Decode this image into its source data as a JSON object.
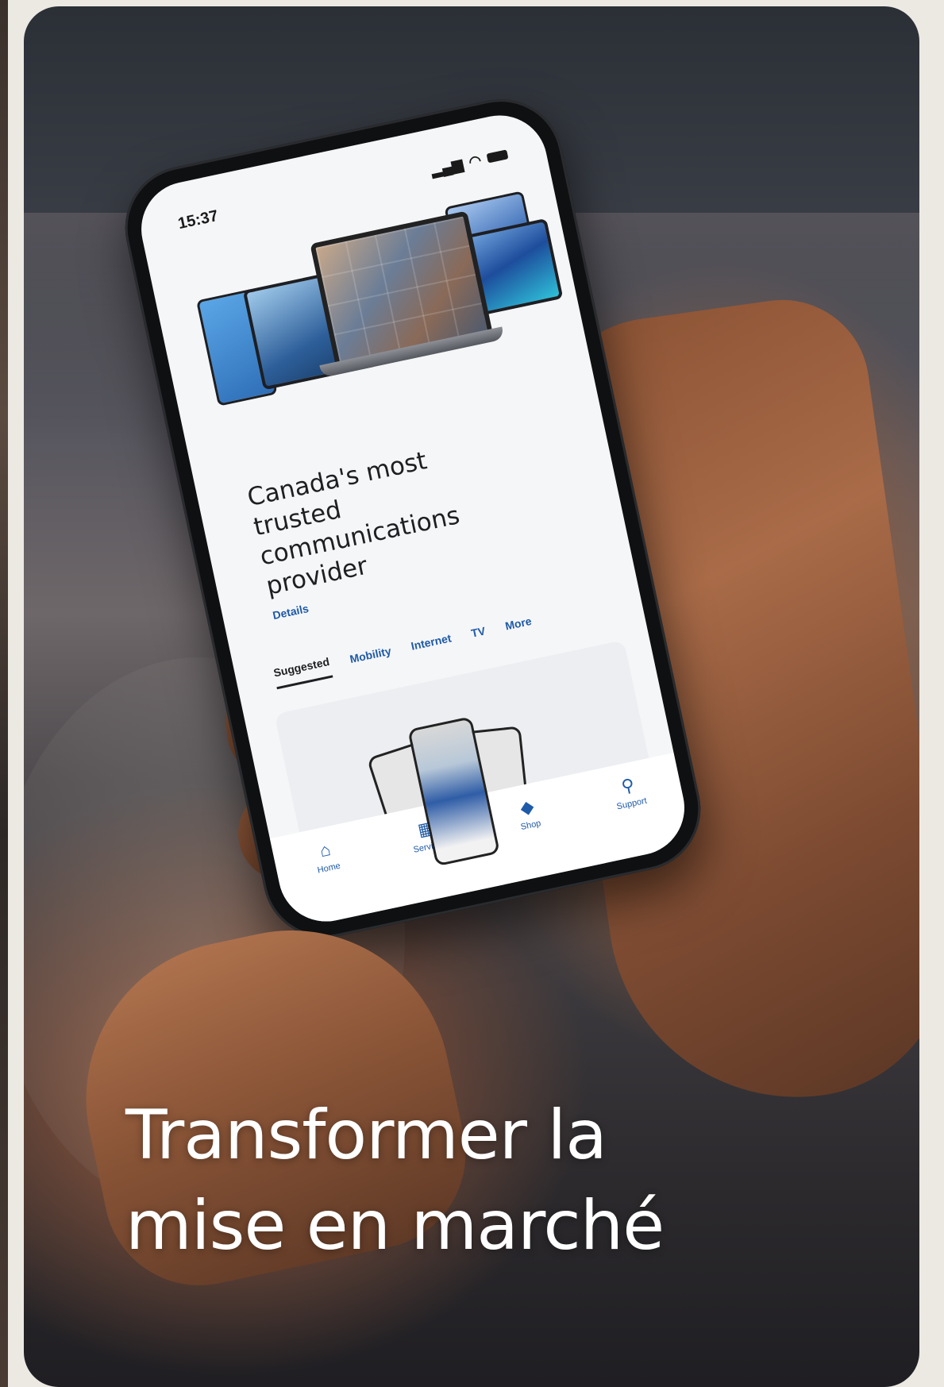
{
  "colors": {
    "page_background": "#ece9e3",
    "accent": "#1e5aa8"
  },
  "phone": {
    "status": {
      "time": "15:37"
    },
    "hero": {
      "headline": "Canada's most trusted communications provider",
      "details_link": "Details"
    },
    "tabs": [
      "Suggested",
      "Mobility",
      "Internet",
      "TV",
      "More"
    ],
    "active_tab": "Suggested",
    "bottom_nav": [
      {
        "label": "Home",
        "icon": "home-icon"
      },
      {
        "label": "Services",
        "icon": "grid-icon"
      },
      {
        "label": "Shop",
        "icon": "tag-icon"
      },
      {
        "label": "Support",
        "icon": "wrench-icon"
      }
    ]
  },
  "caption": {
    "line1": "Transformer la",
    "line2": "mise en marché"
  }
}
